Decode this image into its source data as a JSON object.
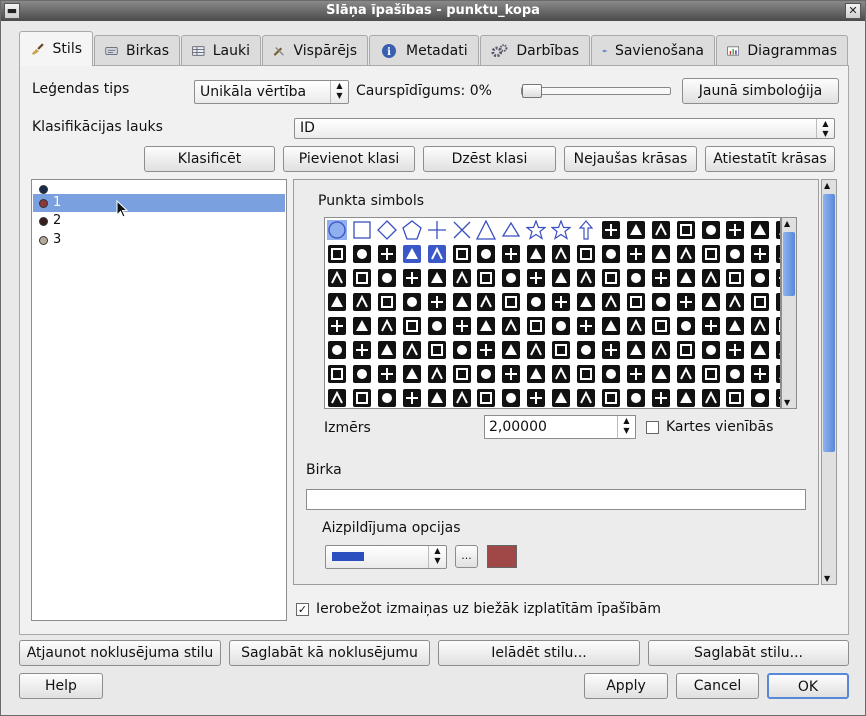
{
  "window": {
    "title": "Slāņa īpašības - punktu_kopa"
  },
  "tabs": [
    {
      "label": "Stils",
      "icon": "paintbrush-icon"
    },
    {
      "label": "Birkas",
      "icon": "label-icon"
    },
    {
      "label": "Lauki",
      "icon": "table-icon"
    },
    {
      "label": "Vispārējs",
      "icon": "tools-icon"
    },
    {
      "label": "Metadati",
      "icon": "info-icon"
    },
    {
      "label": "Darbības",
      "icon": "gears-icon"
    },
    {
      "label": "Savienošana",
      "icon": "join-icon"
    },
    {
      "label": "Diagrammas",
      "icon": "chart-icon"
    }
  ],
  "style": {
    "legend_type_label": "Leģendas tips",
    "legend_type_value": "Unikāla vērtība",
    "transparency_label": "Caurspīdīgums: 0%",
    "transparency_percent": 0,
    "new_symbology_button": "Jaunā simboloģija",
    "classification_field_label": "Klasifikācijas lauks",
    "classification_field_value": "ID",
    "buttons": {
      "classify": "Klasificēt",
      "add_class": "Pievienot klasi",
      "delete_class": "Dzēst klasi",
      "random_colors": "Nejaušas krāsas",
      "reset_colors": "Atiestatīt krāsas"
    },
    "classes": [
      {
        "label": "",
        "color": "#1a2a4a"
      },
      {
        "label": "1",
        "color": "#8a3a3a"
      },
      {
        "label": "2",
        "color": "#3a1e1e"
      },
      {
        "label": "3",
        "color": "#b7a99a"
      }
    ],
    "selected_class_index": 1,
    "point_symbol_label": "Punkta simbols",
    "size_label": "Izmērs",
    "size_value": "2,00000",
    "map_units_label": "Kartes vienībās",
    "map_units_checked": false,
    "label_field_label": "Birka",
    "label_field_value": "",
    "fill_options_label": "Aizpildījuma opcijas",
    "fill_pattern_color": "#2b4fbf",
    "fill_color": "#a04848",
    "color_dots_label": "...",
    "restrict_label": "Ierobežot izmaiņas uz biežāk izplatītām īpašībām",
    "restrict_checked": true
  },
  "footer": {
    "restore_default": "Atjaunot noklusējuma stilu",
    "save_default": "Saglabāt kā noklusējumu",
    "load_style": "Ielādēt stilu...",
    "save_style": "Saglabāt stilu...",
    "help": "Help",
    "apply": "Apply",
    "cancel": "Cancel",
    "ok": "OK"
  },
  "colors": {
    "accent": "#7aa0e0",
    "selection": "#5a88d8"
  }
}
